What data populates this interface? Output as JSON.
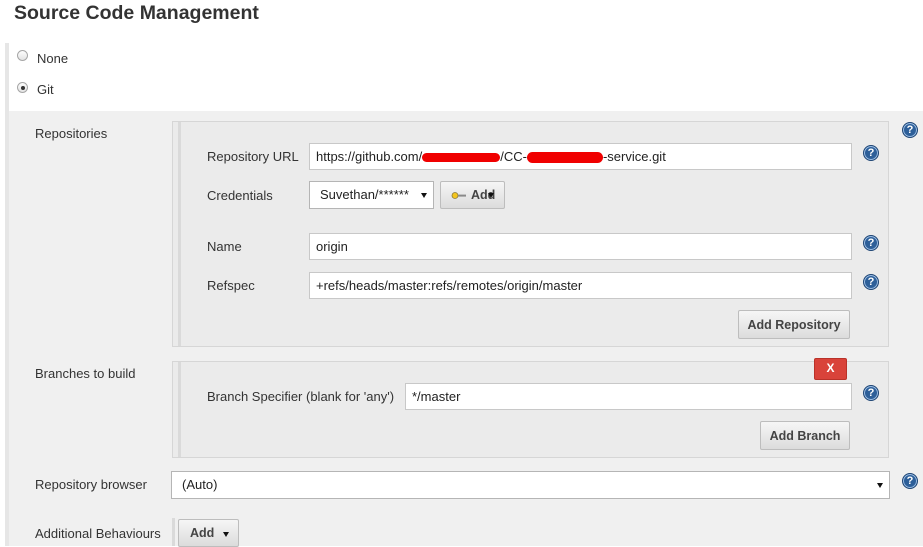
{
  "page": {
    "title": "Source Code Management"
  },
  "scm_options": [
    {
      "label": "None",
      "selected": false
    },
    {
      "label": "Git",
      "selected": true
    }
  ],
  "repositories": {
    "section_label": "Repositories",
    "url_label": "Repository URL",
    "url_value": "https://github.com/",
    "url_value_mid": "/CC-",
    "url_value_end": "-service.git",
    "credentials_label": "Credentials",
    "credentials_value": "Suvethan/******",
    "add_label": "Add",
    "name_label": "Name",
    "name_value": "origin",
    "refspec_label": "Refspec",
    "refspec_value": "+refs/heads/master:refs/remotes/origin/master",
    "add_repository_label": "Add Repository"
  },
  "branches": {
    "section_label": "Branches to build",
    "specifier_label": "Branch Specifier (blank for 'any')",
    "specifier_value": "*/master",
    "delete_label": "X",
    "add_branch_label": "Add Branch"
  },
  "repo_browser": {
    "label": "Repository browser",
    "value": "(Auto)"
  },
  "additional_behaviours": {
    "label": "Additional Behaviours",
    "add_label": "Add"
  },
  "help_glyph": "?",
  "colors": {
    "help": "#2d5f99",
    "delete": "#d9433a",
    "redaction": "#f00000"
  }
}
